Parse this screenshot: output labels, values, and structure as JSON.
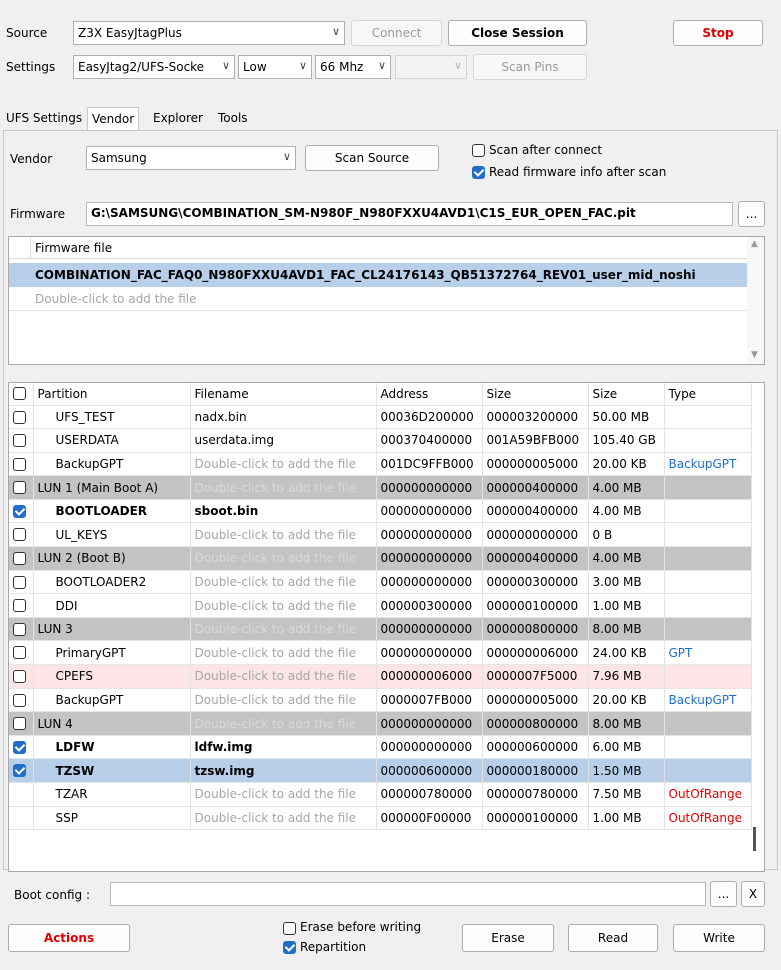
{
  "top": {
    "source_label": "Source",
    "source_value": "Z3X EasyJtagPlus",
    "connect_label": "Connect",
    "close_session_label": "Close Session",
    "stop_label": "Stop",
    "settings_label": "Settings",
    "adapter_value": "EasyJtag2/UFS-Socke",
    "speed_mode_value": "Low",
    "frequency_value": "66 Mhz",
    "voltage_value": "",
    "scan_pins_label": "Scan Pins"
  },
  "tabs": [
    "UFS Settings",
    "Vendor",
    "Explorer",
    "Tools"
  ],
  "active_tab": "Vendor",
  "vendor": {
    "vendor_label": "Vendor",
    "vendor_value": "Samsung",
    "scan_source_label": "Scan Source",
    "scan_after_connect_label": "Scan after connect",
    "scan_after_connect_checked": false,
    "read_fw_info_label": "Read firmware info after scan",
    "read_fw_info_checked": true,
    "firmware_label": "Firmware",
    "firmware_path": "G:\\SAMSUNG\\COMBINATION_SM-N980F_N980FXXU4AVD1\\C1S_EUR_OPEN_FAC.pit",
    "browse_label": "..."
  },
  "firmware_list": {
    "header": "Firmware file",
    "rows": [
      "COMBINATION_FAC_FAQ0_N980FXXU4AVD1_FAC_CL24176143_QB51372764_REV01_user_mid_noshi",
      "Double-click to add the file"
    ]
  },
  "partitions": {
    "columns": [
      "Partition",
      "Filename",
      "Address",
      "Size",
      "Size",
      "Type"
    ],
    "rows": [
      {
        "checked": false,
        "partition": "UFS_TEST",
        "filename": "nadx.bin",
        "address": "00036D200000",
        "size_hex": "000003200000",
        "size": "50.00 MB",
        "type": "",
        "style": ""
      },
      {
        "checked": false,
        "partition": "USERDATA",
        "filename": "userdata.img",
        "address": "000370400000",
        "size_hex": "001A59BFB000",
        "size": "105.40 GB",
        "type": "",
        "style": ""
      },
      {
        "checked": false,
        "partition": "BackupGPT",
        "filename": "Double-click to add the file",
        "address": "001DC9FFB000",
        "size_hex": "000000005000",
        "size": "20.00 KB",
        "type": "BackupGPT",
        "style": ""
      },
      {
        "checked": false,
        "partition": "LUN 1 (Main Boot A)",
        "filename": "Double-click to add the file",
        "address": "000000000000",
        "size_hex": "000000400000",
        "size": "4.00 MB",
        "type": "",
        "style": "lun"
      },
      {
        "checked": true,
        "partition": "BOOTLOADER",
        "filename": "sboot.bin",
        "address": "000000000000",
        "size_hex": "000000400000",
        "size": "4.00 MB",
        "type": "",
        "style": "bold"
      },
      {
        "checked": false,
        "partition": "UL_KEYS",
        "filename": "Double-click to add the file",
        "address": "000000000000",
        "size_hex": "000000000000",
        "size": "0 B",
        "type": "",
        "style": ""
      },
      {
        "checked": false,
        "partition": "LUN 2 (Boot B)",
        "filename": "Double-click to add the file",
        "address": "000000000000",
        "size_hex": "000000400000",
        "size": "4.00 MB",
        "type": "",
        "style": "lun"
      },
      {
        "checked": false,
        "partition": "BOOTLOADER2",
        "filename": "Double-click to add the file",
        "address": "000000000000",
        "size_hex": "000000300000",
        "size": "3.00 MB",
        "type": "",
        "style": ""
      },
      {
        "checked": false,
        "partition": "DDI",
        "filename": "Double-click to add the file",
        "address": "000000300000",
        "size_hex": "000000100000",
        "size": "1.00 MB",
        "type": "",
        "style": ""
      },
      {
        "checked": false,
        "partition": "LUN 3",
        "filename": "Double-click to add the file",
        "address": "000000000000",
        "size_hex": "000000800000",
        "size": "8.00 MB",
        "type": "",
        "style": "lun"
      },
      {
        "checked": false,
        "partition": "PrimaryGPT",
        "filename": "Double-click to add the file",
        "address": "000000000000",
        "size_hex": "000000006000",
        "size": "24.00 KB",
        "type": "GPT",
        "style": ""
      },
      {
        "checked": false,
        "partition": "CPEFS",
        "filename": "Double-click to add the file",
        "address": "000000006000",
        "size_hex": "0000007F5000",
        "size": "7.96 MB",
        "type": "",
        "style": "pink"
      },
      {
        "checked": false,
        "partition": "BackupGPT",
        "filename": "Double-click to add the file",
        "address": "0000007FB000",
        "size_hex": "000000005000",
        "size": "20.00 KB",
        "type": "BackupGPT",
        "style": ""
      },
      {
        "checked": false,
        "partition": "LUN 4",
        "filename": "Double-click to add the file",
        "address": "000000000000",
        "size_hex": "000000800000",
        "size": "8.00 MB",
        "type": "",
        "style": "lun"
      },
      {
        "checked": true,
        "partition": "LDFW",
        "filename": "ldfw.img",
        "address": "000000000000",
        "size_hex": "000000600000",
        "size": "6.00 MB",
        "type": "",
        "style": "bold"
      },
      {
        "checked": true,
        "partition": "TZSW",
        "filename": "tzsw.img",
        "address": "000000600000",
        "size_hex": "000000180000",
        "size": "1.50 MB",
        "type": "",
        "style": "bold sel"
      },
      {
        "checked": null,
        "partition": "TZAR",
        "filename": "Double-click to add the file",
        "address": "000000780000",
        "size_hex": "000000780000",
        "size": "7.50 MB",
        "type": "OutOfRange",
        "style": ""
      },
      {
        "checked": null,
        "partition": "SSP",
        "filename": "Double-click to add the file",
        "address": "000000F00000",
        "size_hex": "000000100000",
        "size": "1.00 MB",
        "type": "OutOfRange",
        "style": ""
      }
    ]
  },
  "bottom": {
    "boot_config_label": "Boot config :",
    "boot_config_value": "",
    "browse_label": "...",
    "clear_label": "X",
    "actions_label": "Actions",
    "erase_before_writing_label": "Erase before writing",
    "erase_before_writing_checked": false,
    "repartition_label": "Repartition",
    "repartition_checked": true,
    "erase_label": "Erase",
    "read_label": "Read",
    "write_label": "Write"
  },
  "colors": {
    "stop_red": "#e00000",
    "link_blue": "#1f6fc8",
    "selection": "#b8cfe9",
    "lun_gray": "#c3c3c3",
    "warning_pink": "#fde4e6"
  }
}
